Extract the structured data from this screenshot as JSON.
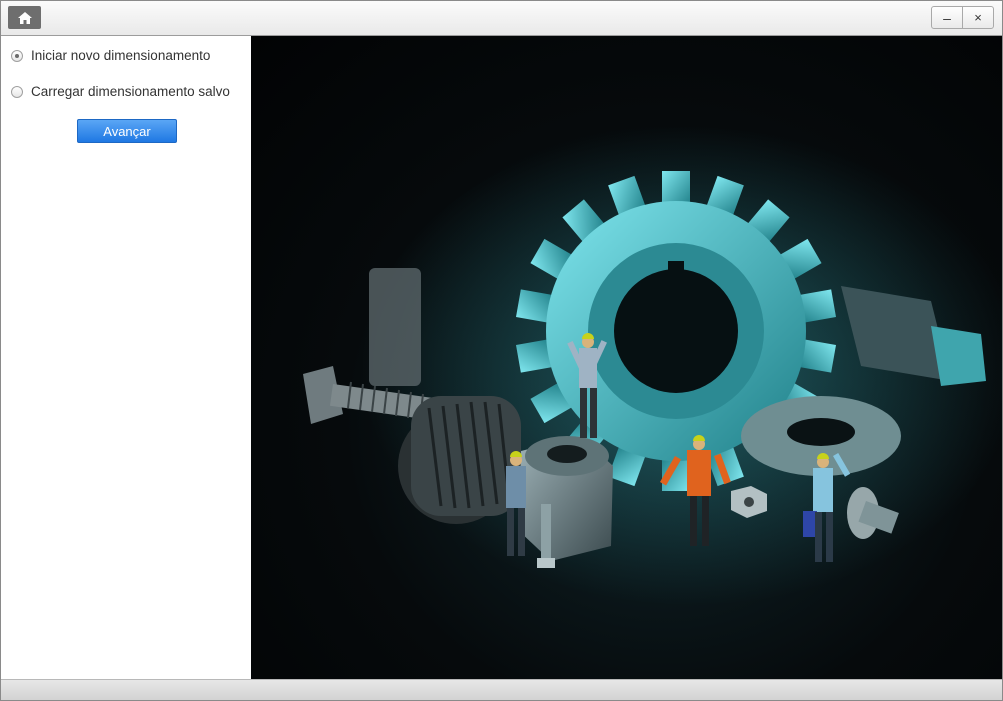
{
  "titlebar": {
    "home_icon": "home-icon",
    "minimize_label": "–",
    "close_label": "×"
  },
  "options": {
    "new_label": "Iniciar novo dimensionamento",
    "load_label": "Carregar dimensionamento salvo",
    "selected": "new"
  },
  "actions": {
    "advance_label": "Avançar"
  },
  "image": {
    "subject": "miniature-workers-gear-photo",
    "accent_color": "#3fc6d0"
  }
}
